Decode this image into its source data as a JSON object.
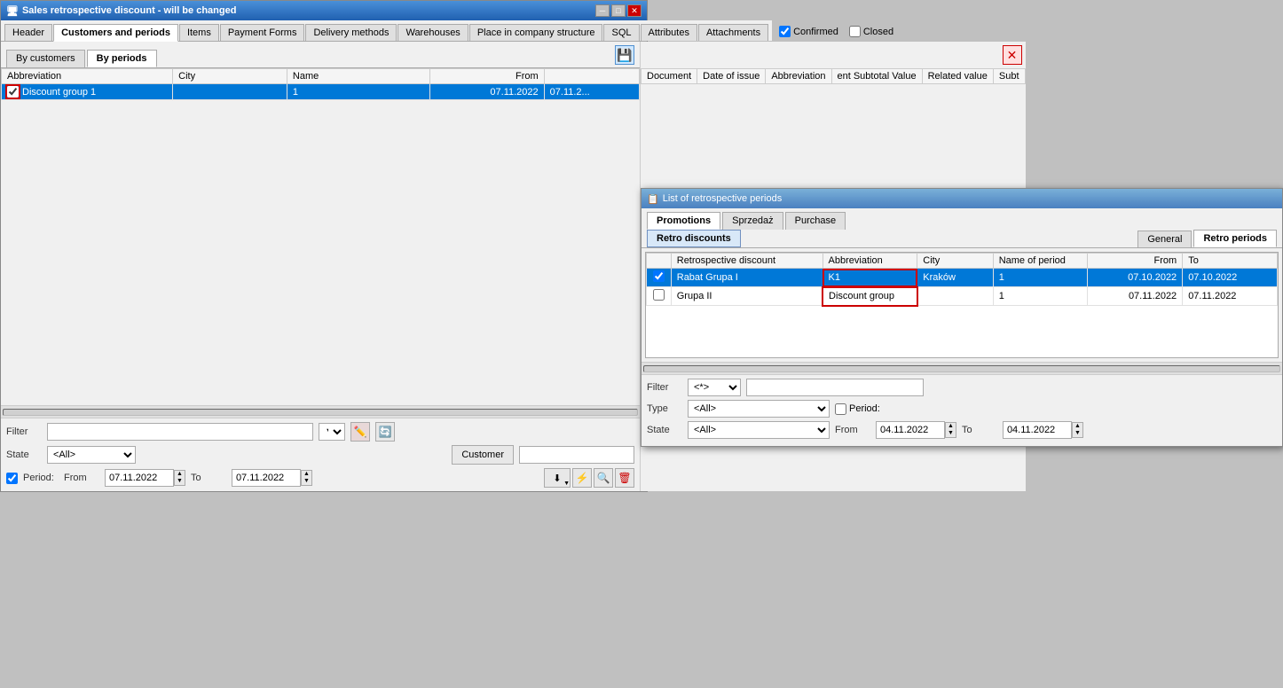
{
  "window": {
    "title": "Sales retrospective discount - will be changed",
    "tabs": [
      {
        "label": "Header",
        "active": false
      },
      {
        "label": "Customers and periods",
        "active": true
      },
      {
        "label": "Items",
        "active": false
      },
      {
        "label": "Payment Forms",
        "active": false
      },
      {
        "label": "Delivery methods",
        "active": false
      },
      {
        "label": "Warehouses",
        "active": false
      },
      {
        "label": "Place in company structure",
        "active": false
      },
      {
        "label": "SQL",
        "active": false
      },
      {
        "label": "Attributes",
        "active": false
      },
      {
        "label": "Attachments",
        "active": false
      }
    ],
    "confirmed_label": "Confirmed",
    "closed_label": "Closed"
  },
  "subtabs": [
    {
      "label": "By customers",
      "active": false
    },
    {
      "label": "By periods",
      "active": true
    }
  ],
  "grid": {
    "columns": [
      "Abbreviation",
      "City",
      "Name",
      "From",
      ""
    ],
    "rows": [
      {
        "checkbox": true,
        "abbreviation": "Discount group 1",
        "city": "",
        "name": "1",
        "from": "07.11.2022",
        "to": "07.11.2...",
        "selected": true
      }
    ]
  },
  "right_grid": {
    "columns": [
      "Document",
      "Date of issue",
      "Abbreviation",
      "ent Subtotal Value",
      "Related value",
      "Subt"
    ],
    "rows": []
  },
  "filter": {
    "label": "Filter",
    "state_label": "State",
    "state_value": "<All>",
    "customer_btn": "Customer",
    "period_label": "Period:",
    "from_label": "From",
    "from_date": "07.11.2022",
    "to_label": "To",
    "to_date": "07.11.2022"
  },
  "retro_window": {
    "title": "List of retrospective periods",
    "tabs_row1": [
      {
        "label": "Promotions",
        "active": true
      },
      {
        "label": "Sprzedaż",
        "active": false
      },
      {
        "label": "Purchase",
        "active": false
      }
    ],
    "tabs_row2a": [
      {
        "label": "Retro discounts",
        "active": true
      }
    ],
    "tabs_row2b": [
      {
        "label": "General",
        "active": false
      },
      {
        "label": "Retro periods",
        "active": true
      }
    ],
    "grid": {
      "columns": [
        "Retrospective discount",
        "Abbreviation",
        "City",
        "Name of period",
        "From",
        "To"
      ],
      "rows": [
        {
          "checkbox": true,
          "discount": "Rabat Grupa I",
          "abbreviation": "K1",
          "city": "Kraków",
          "name_period": "1",
          "from": "07.10.2022",
          "to": "07.10.2022",
          "selected": true,
          "abbr_outlined": false
        },
        {
          "checkbox": false,
          "discount": "Grupa II",
          "abbreviation": "Discount group",
          "city": "",
          "name_period": "1",
          "from": "07.11.2022",
          "to": "07.11.2022",
          "selected": false,
          "abbr_outlined": true
        }
      ]
    },
    "filter": {
      "label": "Filter",
      "filter_value": "<*>",
      "type_label": "Type",
      "type_value": "<All>",
      "period_label": "Period:",
      "state_label": "State",
      "state_value": "<All>",
      "from_label": "From",
      "from_date": "04.11.2022",
      "to_label": "To",
      "to_date": "04.11.2022"
    }
  }
}
